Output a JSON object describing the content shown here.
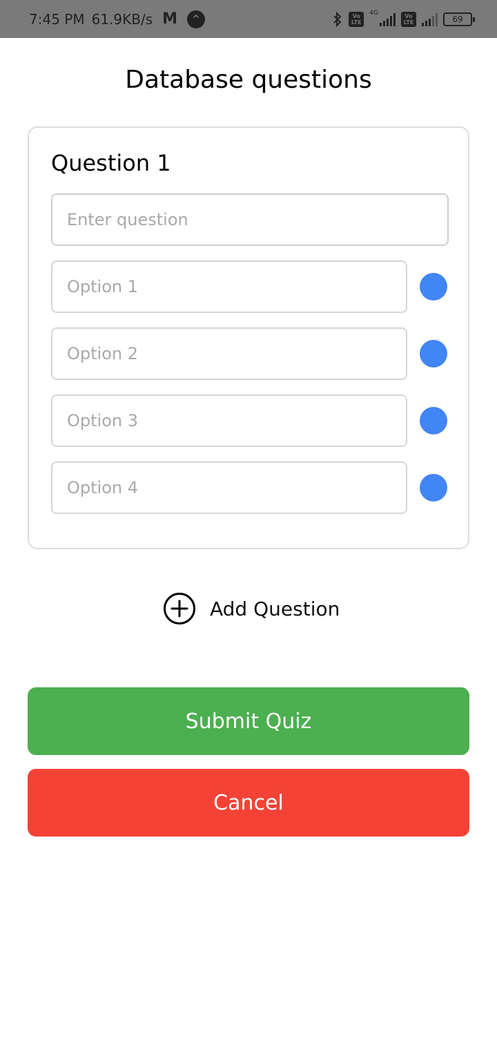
{
  "status_bar": {
    "time": "7:45 PM",
    "net_speed": "61.9KB/s",
    "mail_icon": "M",
    "nav_badge": "^",
    "bluetooth_icon": "bluetooth-icon",
    "network_label": "4G",
    "volte_1": "Vo LTE",
    "volte_2": "Vo LTE",
    "battery": "69"
  },
  "page": {
    "title": "Database questions"
  },
  "question": {
    "heading": "Question 1",
    "placeholder": "Enter question",
    "value": "",
    "options": [
      {
        "placeholder": "Option 1",
        "value": ""
      },
      {
        "placeholder": "Option 2",
        "value": ""
      },
      {
        "placeholder": "Option 3",
        "value": ""
      },
      {
        "placeholder": "Option 4",
        "value": ""
      }
    ],
    "radio_color": "#4285f4"
  },
  "add_question": {
    "label": "Add Question",
    "icon": "plus-circle-icon"
  },
  "buttons": {
    "submit_label": "Submit Quiz",
    "submit_color": "#4caf50",
    "cancel_label": "Cancel",
    "cancel_color": "#f44336"
  }
}
